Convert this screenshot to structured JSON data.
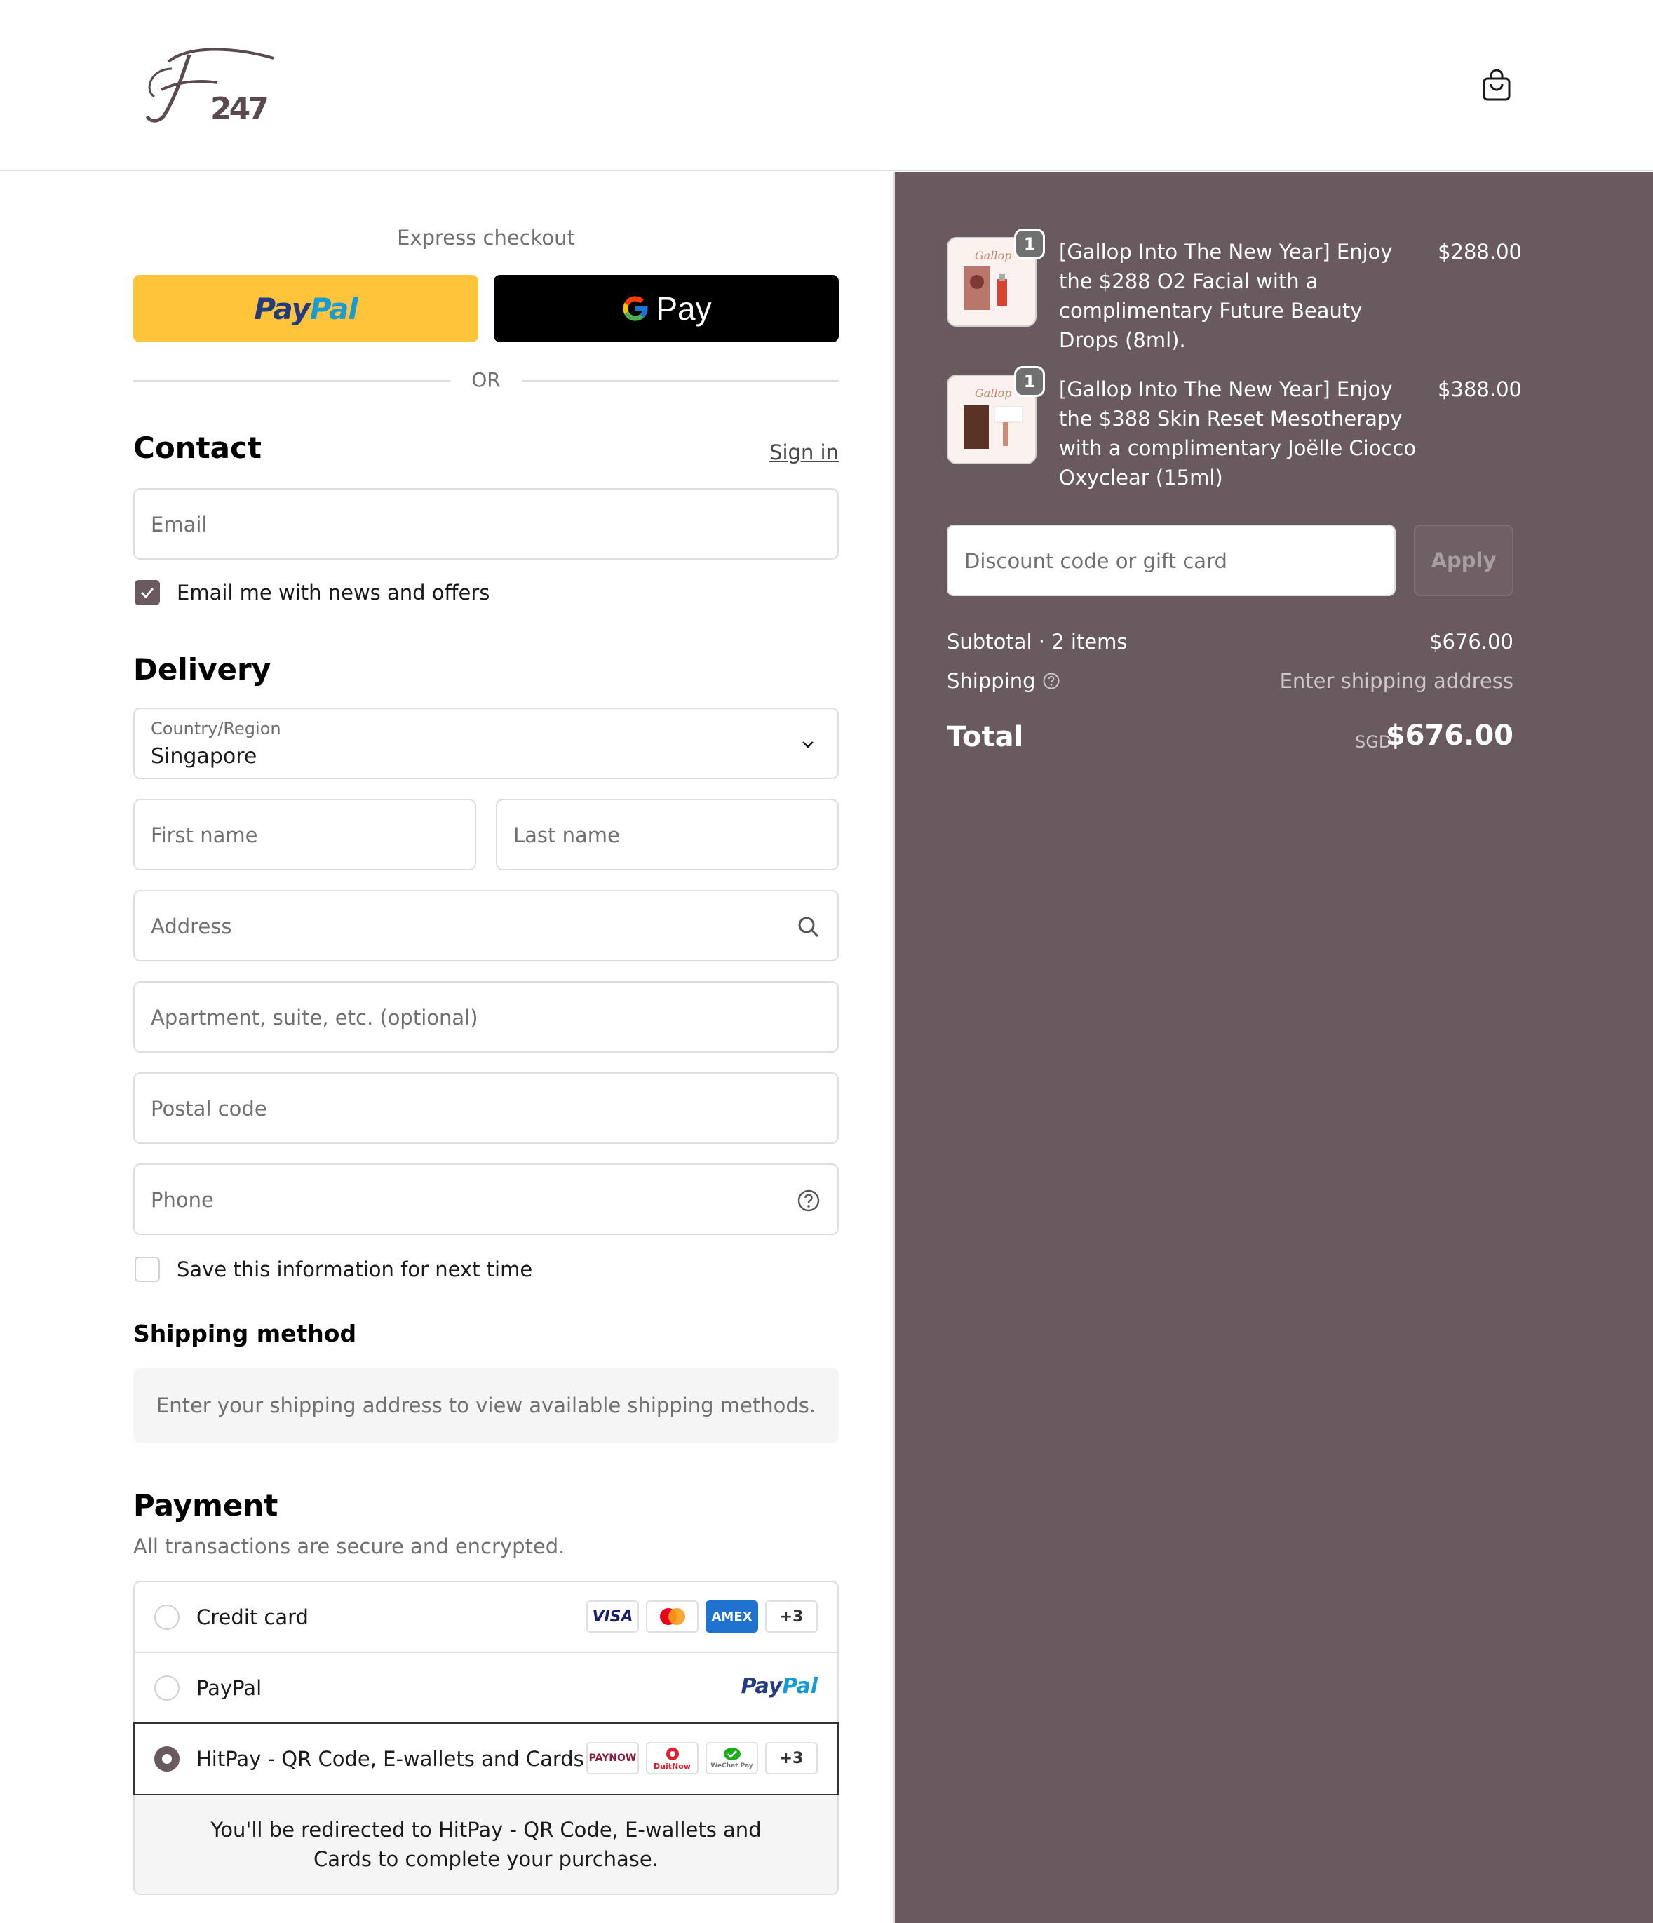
{
  "header": {
    "logo_alt": "F247",
    "cart_icon": "shopping-bag-icon"
  },
  "express": {
    "title": "Express checkout",
    "paypal_label_1": "Pay",
    "paypal_label_2": "Pal",
    "gpay_label": "Pay",
    "or_label": "OR"
  },
  "contact": {
    "heading": "Contact",
    "sign_in": "Sign in",
    "email_placeholder": "Email",
    "newsletter_label": "Email me with news and offers",
    "newsletter_checked": true
  },
  "delivery": {
    "heading": "Delivery",
    "country_label": "Country/Region",
    "country_value": "Singapore",
    "first_name_placeholder": "First name",
    "last_name_placeholder": "Last name",
    "address_placeholder": "Address",
    "apartment_placeholder": "Apartment, suite, etc. (optional)",
    "postal_placeholder": "Postal code",
    "phone_placeholder": "Phone",
    "save_info_label": "Save this information for next time",
    "save_info_checked": false
  },
  "shipping_method": {
    "heading": "Shipping method",
    "info": "Enter your shipping address to view available shipping methods."
  },
  "payment": {
    "heading": "Payment",
    "subtitle": "All transactions are secure and encrypted.",
    "options": [
      {
        "label": "Credit card",
        "badges": [
          "VISA",
          "MC",
          "AMEX",
          "+3"
        ],
        "selected": false
      },
      {
        "label": "PayPal",
        "selected": false
      },
      {
        "label": "HitPay - QR Code, E-wallets and Cards",
        "badges": [
          "PAYNOW",
          "DuitNow",
          "WeChat Pay",
          "+3"
        ],
        "selected": true
      }
    ],
    "redirect_text": "You'll be redirected to HitPay - QR Code, E-wallets and Cards to complete your purchase."
  },
  "summary": {
    "items": [
      {
        "quantity": "1",
        "name": "[Gallop Into The New Year] Enjoy the $288 O2 Facial with a complimentary Future Beauty Drops (8ml).",
        "price": "$288.00"
      },
      {
        "quantity": "1",
        "name": "[Gallop Into The New Year] Enjoy the $388 Skin Reset Mesotherapy with a complimentary Joëlle Ciocco Oxyclear (15ml)",
        "price": "$388.00"
      }
    ],
    "discount_placeholder": "Discount code or gift card",
    "apply_label": "Apply",
    "subtotal_label": "Subtotal · 2 items",
    "subtotal_value": "$676.00",
    "shipping_label": "Shipping",
    "shipping_value": "Enter shipping address",
    "total_label": "Total",
    "total_currency": "SGD",
    "total_value": "$676.00"
  },
  "colors": {
    "accent": "#685a5f",
    "paypal_yellow": "#ffc439",
    "gpay_black": "#000000"
  }
}
